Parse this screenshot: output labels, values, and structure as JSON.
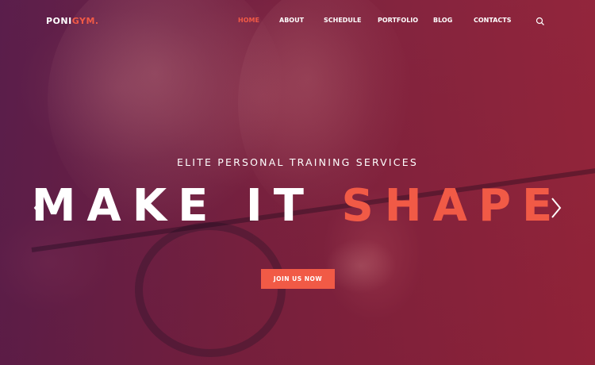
{
  "brand": {
    "name_main": "PONI",
    "name_accent": "GYM."
  },
  "nav": {
    "items": [
      {
        "label": "HOME",
        "active": true
      },
      {
        "label": "ABOUT",
        "active": false
      },
      {
        "label": "SCHEDULE",
        "active": false
      },
      {
        "label": "PORTFOLIO",
        "active": false
      },
      {
        "label": "BLOG",
        "active": false
      },
      {
        "label": "CONTACTS",
        "active": false
      }
    ],
    "search_icon": "search-icon"
  },
  "hero": {
    "subtitle": "ELITE PERSONAL TRAINING SERVICES",
    "headline_main": "MAKE IT",
    "headline_accent": "SHAPE",
    "cta_label": "JOIN US NOW",
    "prev_icon": "chevron-left-icon",
    "next_icon": "chevron-right-icon"
  },
  "colors": {
    "accent": "#f15a46",
    "text": "#ffffff",
    "overlay": "#8a2450"
  }
}
